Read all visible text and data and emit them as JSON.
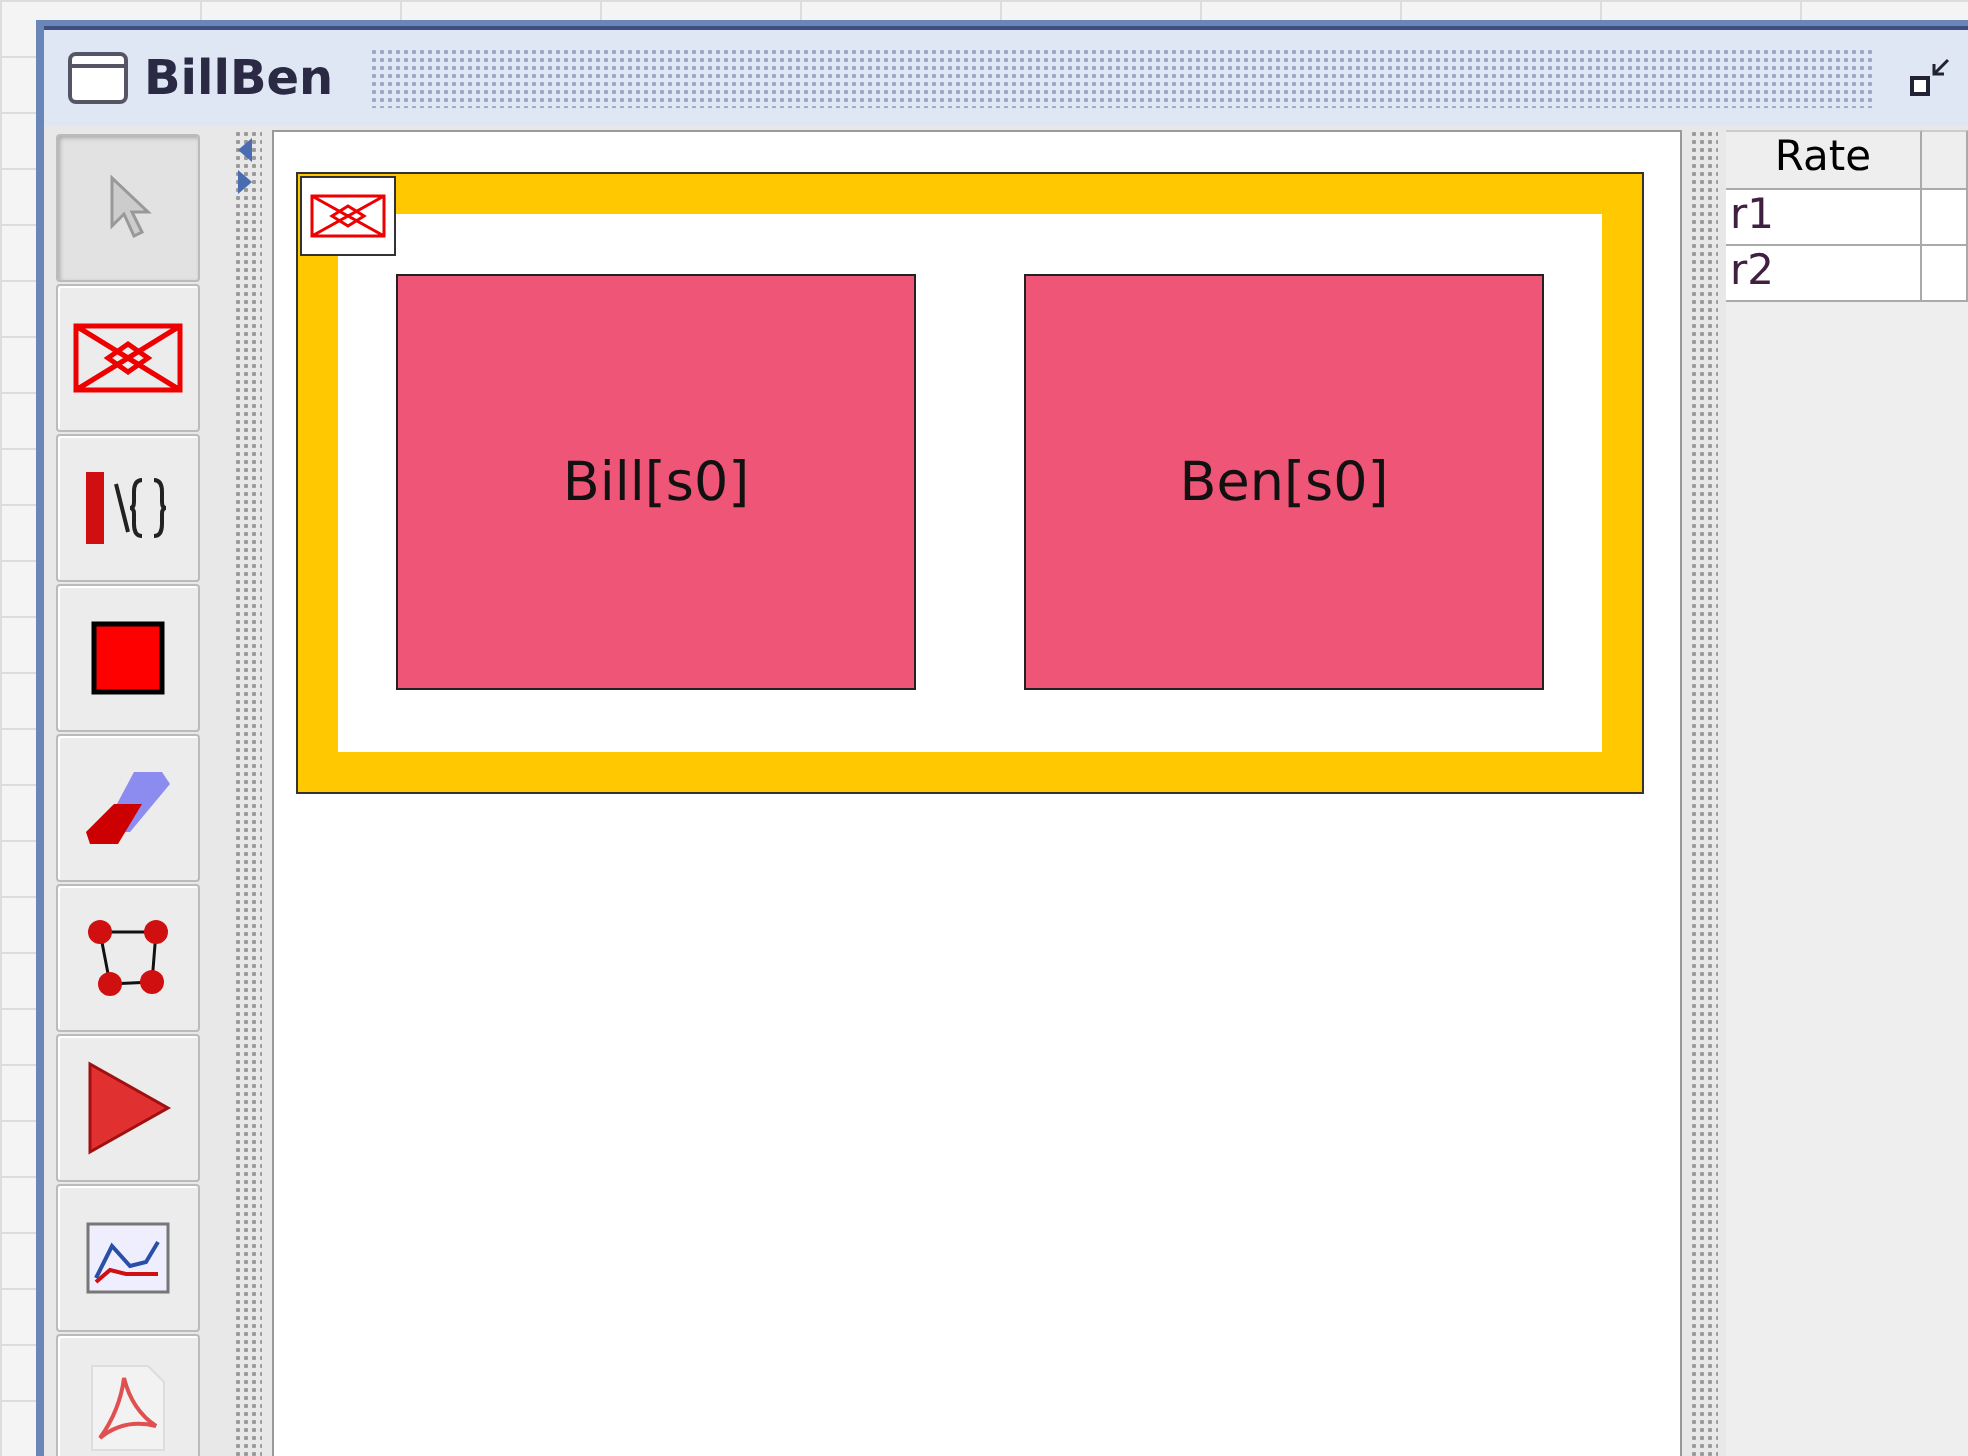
{
  "window": {
    "title": "BillBen"
  },
  "tools": [
    {
      "kind": "pointer",
      "selected": true
    },
    {
      "kind": "compartment",
      "selected": false
    },
    {
      "kind": "rule",
      "selected": false
    },
    {
      "kind": "species",
      "selected": false
    },
    {
      "kind": "eraser",
      "selected": false
    },
    {
      "kind": "graph",
      "selected": false
    },
    {
      "kind": "run",
      "selected": false
    },
    {
      "kind": "plot",
      "selected": false
    },
    {
      "kind": "pdf",
      "selected": false
    }
  ],
  "compartment": {
    "species": [
      {
        "label": "Bill[s0]"
      },
      {
        "label": "Ben[s0]"
      }
    ]
  },
  "table": {
    "columns": [
      "Rate"
    ],
    "rows": [
      {
        "rate": "r1"
      },
      {
        "rate": "r2"
      }
    ]
  }
}
